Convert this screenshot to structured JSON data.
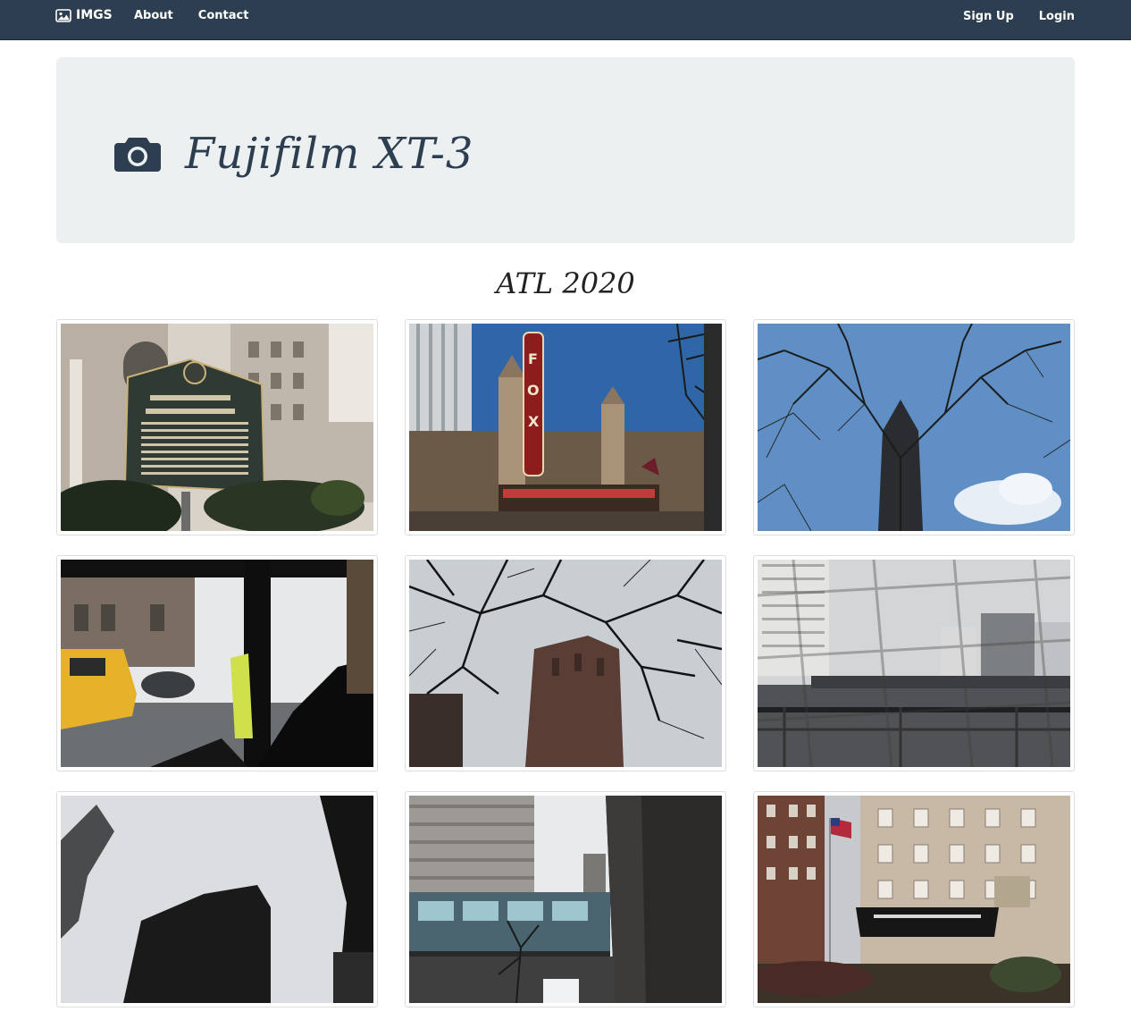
{
  "navbar": {
    "brand": "IMGS",
    "links": [
      "About",
      "Contact"
    ],
    "right_links": [
      "Sign Up",
      "Login"
    ],
    "icons": {
      "brand_icon": "image-icon",
      "title_icon": "camera-icon"
    }
  },
  "jumbotron": {
    "title": "Fujifilm XT-3"
  },
  "album": {
    "title": "ATL 2020"
  },
  "photos": [
    {
      "subject": "georgian-terrace-marker"
    },
    {
      "subject": "fox-theatre-sign"
    },
    {
      "subject": "tower-through-trees"
    },
    {
      "subject": "school-bus-street"
    },
    {
      "subject": "bare-branches-tower"
    },
    {
      "subject": "highway-through-fence"
    },
    {
      "subject": "dark-skyscrapers"
    },
    {
      "subject": "skybridge"
    },
    {
      "subject": "georgian-terrace-hotel"
    }
  ],
  "colors": {
    "navbar_bg": "#2c3e50",
    "jumbotron_bg": "#ecf0f1",
    "text": "#2c3e50"
  }
}
